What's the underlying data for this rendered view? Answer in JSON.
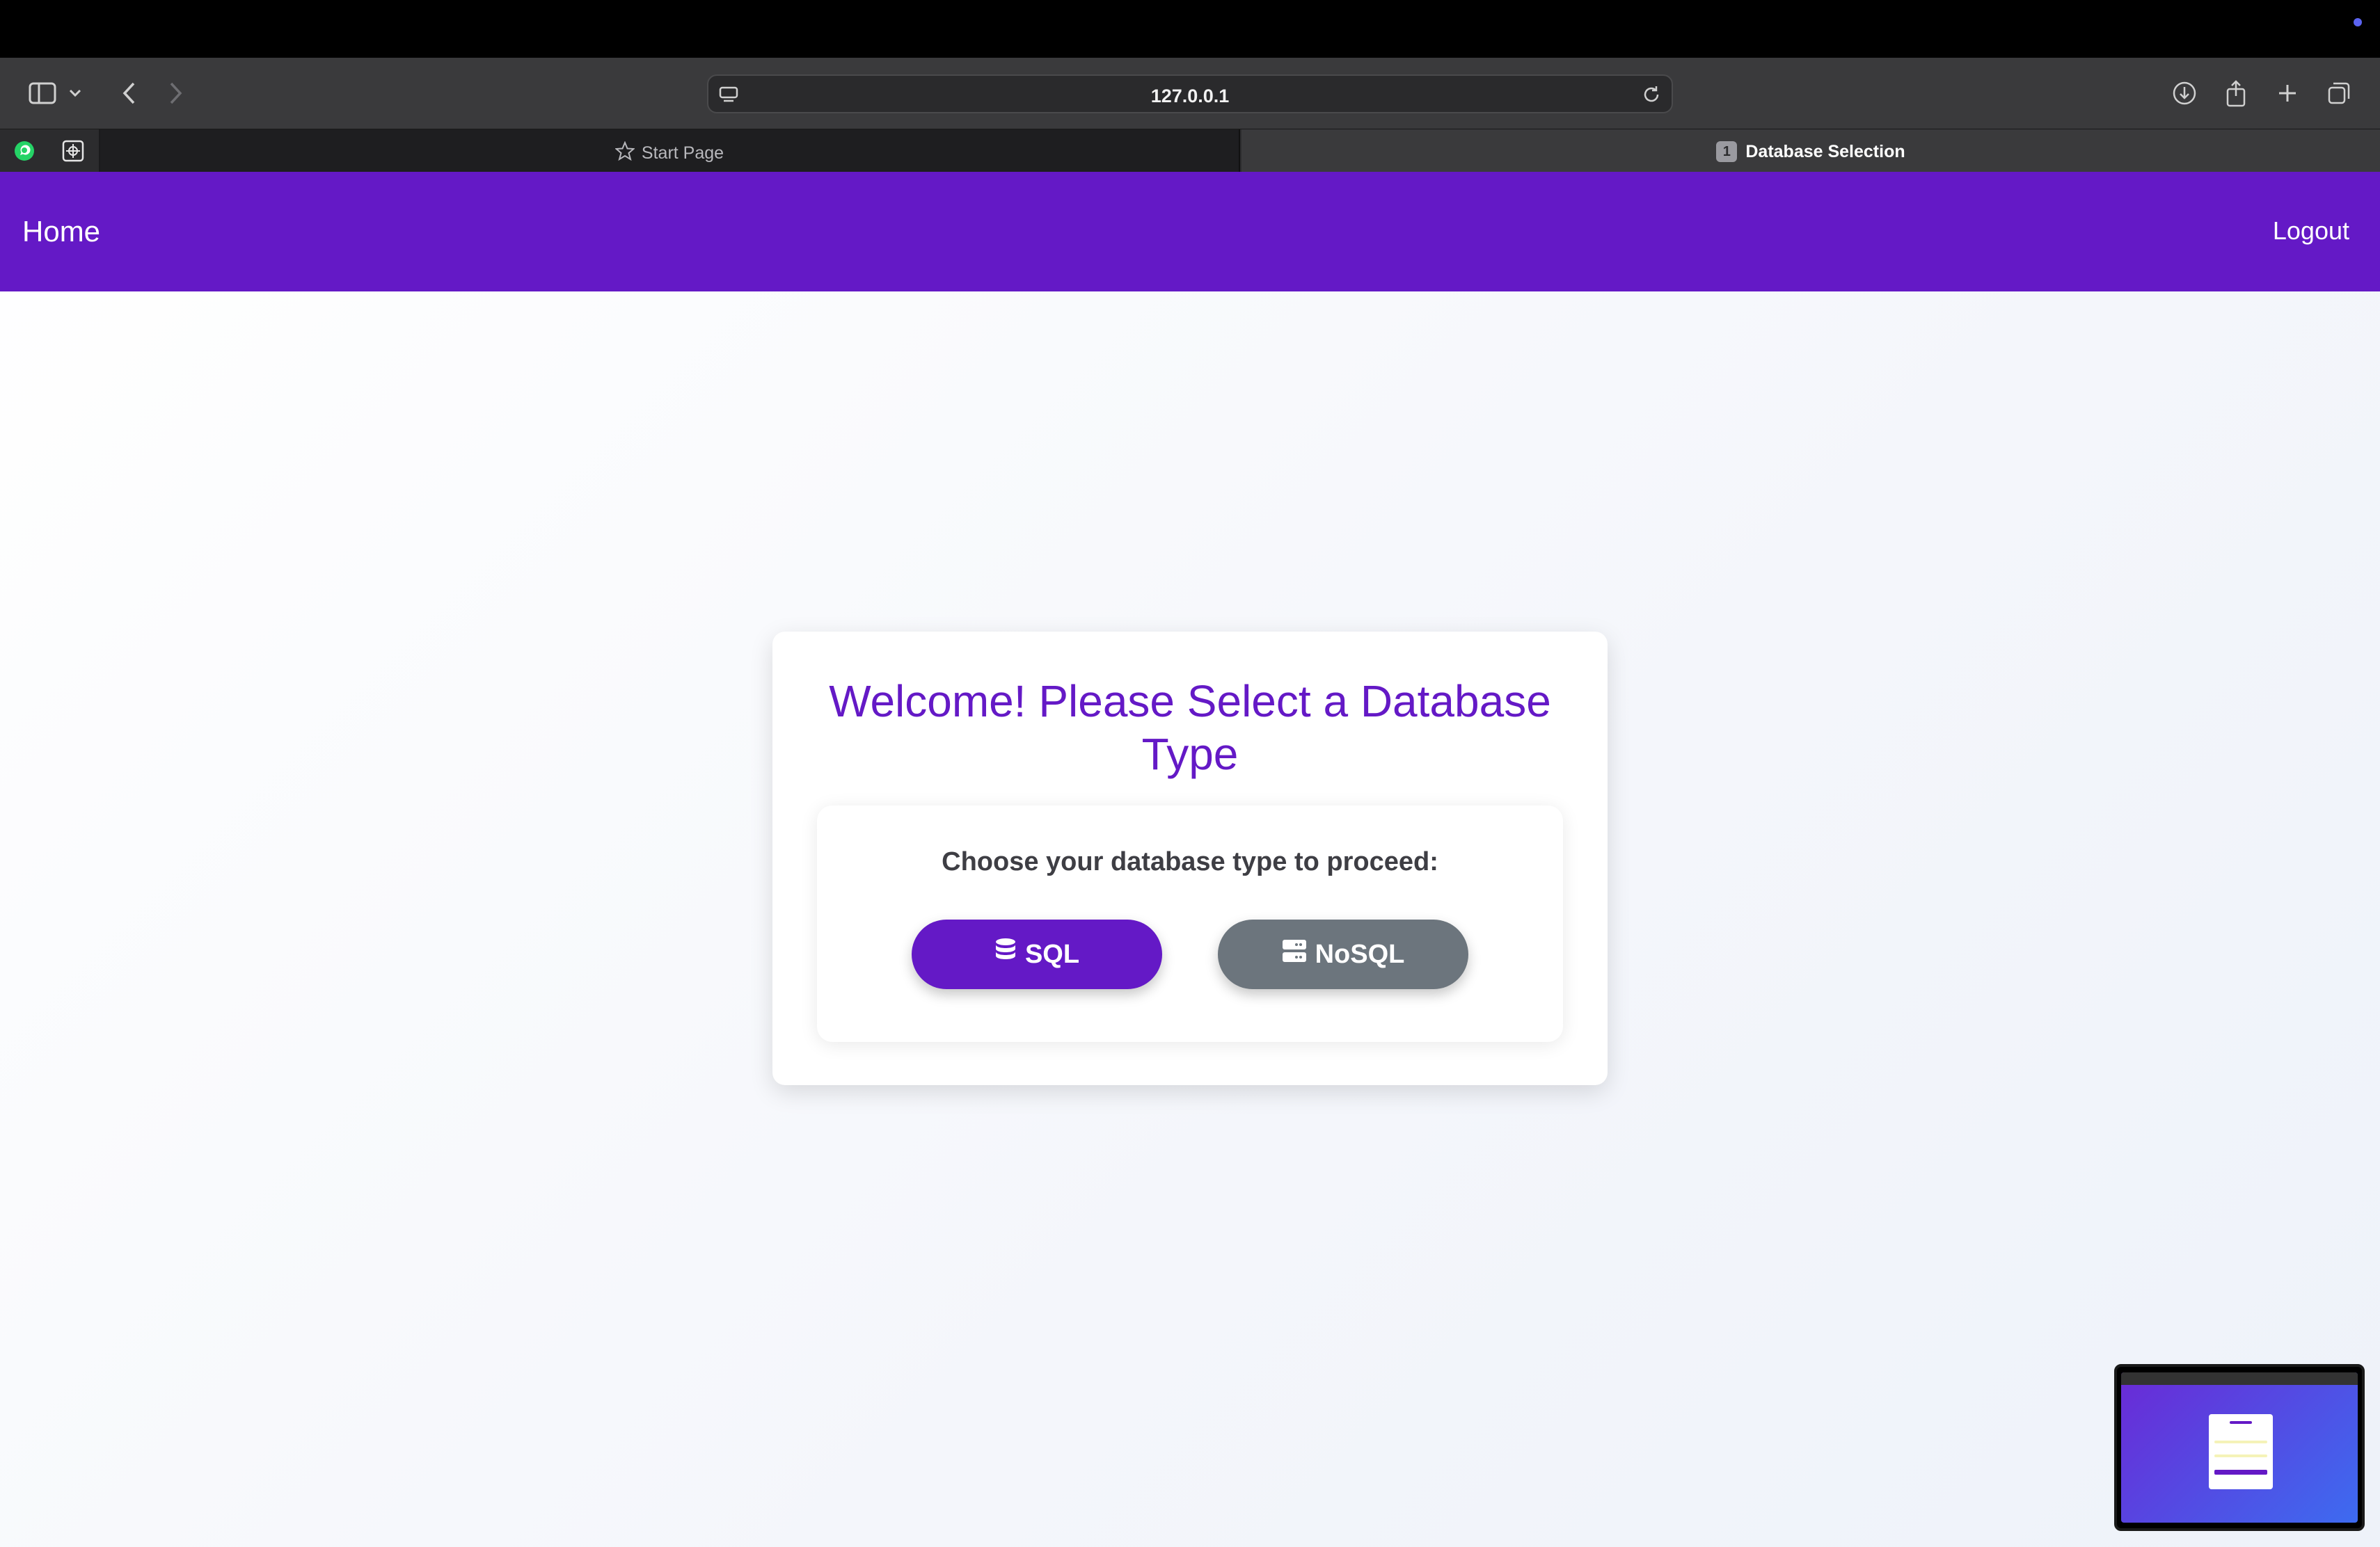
{
  "browser": {
    "url": "127.0.0.1",
    "tabs": [
      {
        "label": "Start Page"
      },
      {
        "label": "Database Selection",
        "badge": "1"
      }
    ],
    "pinned": [
      "whatsapp-icon",
      "extension-icon"
    ]
  },
  "nav": {
    "home_label": "Home",
    "logout_label": "Logout"
  },
  "card": {
    "title": "Welcome! Please Select a Database Type",
    "prompt": "Choose your database type to proceed:",
    "sql_label": "SQL",
    "nosql_label": "NoSQL"
  },
  "colors": {
    "brand": "#6419c6",
    "secondary": "#6c757d"
  }
}
